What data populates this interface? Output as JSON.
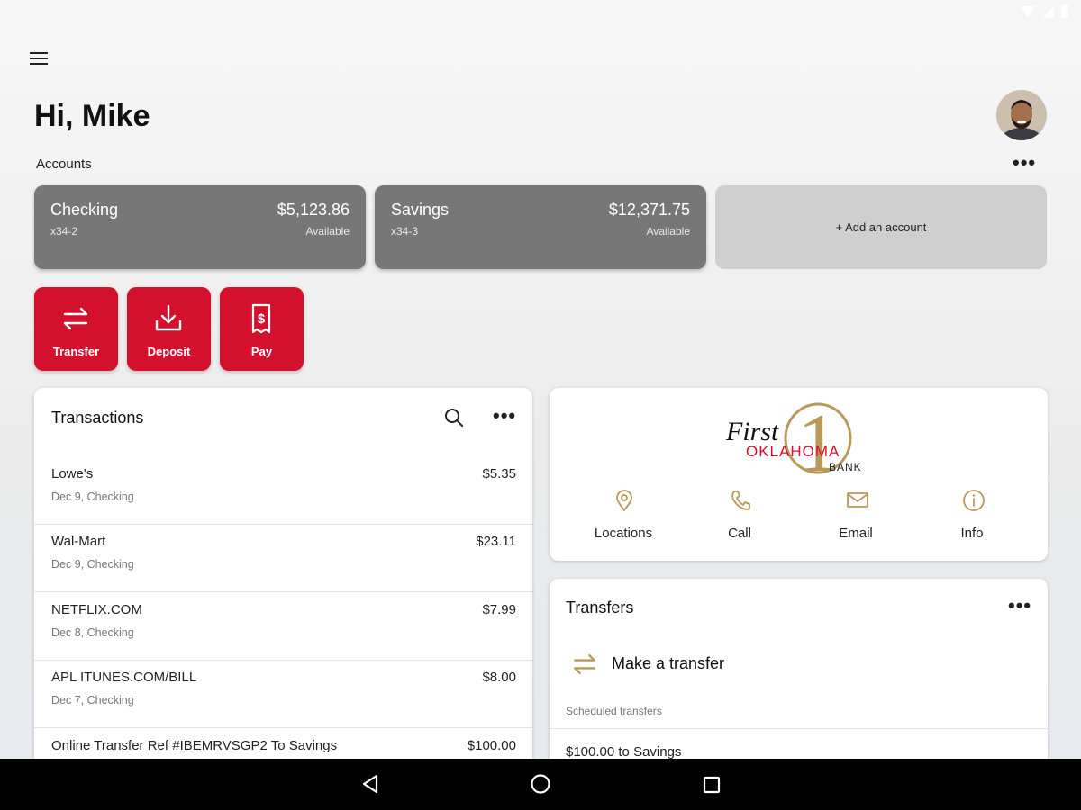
{
  "header": {
    "greeting": "Hi, Mike",
    "accounts_label": "Accounts",
    "more_label": "•••"
  },
  "accounts": [
    {
      "name": "Checking",
      "number": "x34-2",
      "balance": "$5,123.86",
      "balance_label": "Available"
    },
    {
      "name": "Savings",
      "number": "x34-3",
      "balance": "$12,371.75",
      "balance_label": "Available"
    }
  ],
  "add_account_label": "+ Add an account",
  "actions": [
    {
      "label": "Transfer",
      "icon": "transfer-icon"
    },
    {
      "label": "Deposit",
      "icon": "deposit-icon"
    },
    {
      "label": "Pay",
      "icon": "bill-icon"
    }
  ],
  "transactions": {
    "title": "Transactions",
    "more_label": "•••",
    "rows": [
      {
        "name": "Lowe's",
        "detail": "Dec 9, Checking",
        "amount": "$5.35"
      },
      {
        "name": "Wal-Mart",
        "detail": "Dec 9, Checking",
        "amount": "$23.11"
      },
      {
        "name": "NETFLIX.COM",
        "detail": "Dec 8, Checking",
        "amount": "$7.99"
      },
      {
        "name": "APL ITUNES.COM/BILL",
        "detail": "Dec 7, Checking",
        "amount": "$8.00"
      },
      {
        "name": "Online Transfer Ref #IBEMRVSGP2 To Savings",
        "detail": "",
        "amount": "$100.00"
      }
    ]
  },
  "bank": {
    "logo_line1": "First",
    "logo_line2": "OKLAHOMA",
    "logo_line3": "BANK",
    "contacts": [
      {
        "label": "Locations",
        "icon": "location-pin-icon"
      },
      {
        "label": "Call",
        "icon": "phone-icon"
      },
      {
        "label": "Email",
        "icon": "envelope-icon"
      },
      {
        "label": "Info",
        "icon": "info-icon"
      }
    ]
  },
  "transfers": {
    "title": "Transfers",
    "more_label": "•••",
    "make_transfer_label": "Make a transfer",
    "scheduled_label": "Scheduled transfers",
    "scheduled_items": [
      "$100.00 to Savings"
    ]
  },
  "colors": {
    "accent_red": "#d4112d",
    "account_card": "#777777",
    "gold": "#b8995a"
  }
}
